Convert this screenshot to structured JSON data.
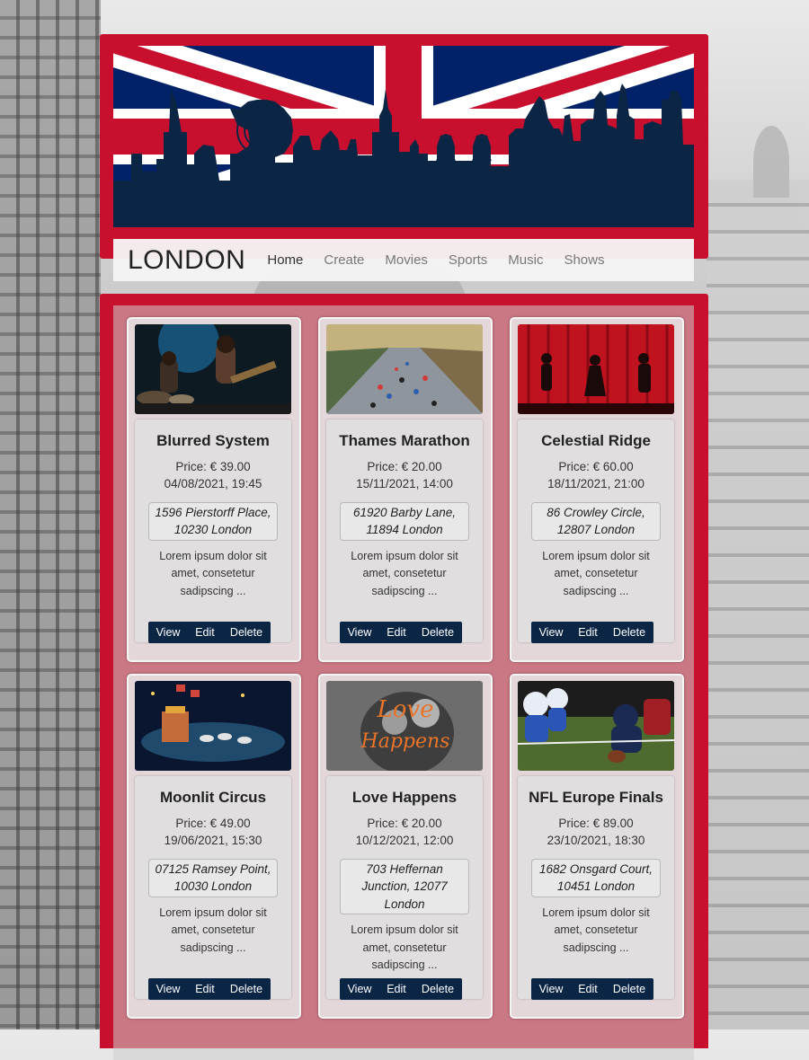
{
  "site": {
    "brand": "LONDON"
  },
  "nav": [
    {
      "label": "Home",
      "active": true
    },
    {
      "label": "Create"
    },
    {
      "label": "Movies"
    },
    {
      "label": "Sports"
    },
    {
      "label": "Music"
    },
    {
      "label": "Shows"
    }
  ],
  "colors": {
    "frame": "#c8102e",
    "button": "#0b2545",
    "flag_blue": "#012169"
  },
  "events": [
    {
      "title": "Blurred System",
      "price": "Price:  € 39.00",
      "date": "04/08/2021, 19:45",
      "address": "1596 Pierstorff Place, 10230 London",
      "description": "Lorem ipsum dolor sit amet, consetetur sadipscing ...",
      "image": "band-on-stage-image"
    },
    {
      "title": "Thames Marathon",
      "price": "Price:  € 20.00",
      "date": "15/11/2021, 14:00",
      "address": "61920 Barby Lane, 11894 London",
      "description": "Lorem ipsum dolor sit amet, consetetur sadipscing ...",
      "image": "marathon-runners-image"
    },
    {
      "title": "Celestial Ridge",
      "price": "Price:  € 60.00",
      "date": "18/11/2021, 21:00",
      "address": "86 Crowley Circle, 12807 London",
      "description": "Lorem ipsum dolor sit amet, consetetur sadipscing ...",
      "image": "theatre-stage-image"
    },
    {
      "title": "Moonlit Circus",
      "price": "Price:  € 49.00",
      "date": "19/06/2021, 15:30",
      "address": "07125 Ramsey Point, 10030 London",
      "description": "Lorem ipsum dolor sit amet, consetetur sadipscing ...",
      "image": "circus-arena-image"
    },
    {
      "title": "Love Happens",
      "price": "Price:  € 20.00",
      "date": "10/12/2021, 12:00",
      "address": "703 Heffernan Junction, 12077 London",
      "description": "Lorem ipsum dolor sit amet, consetetur sadipscing ...",
      "image": "love-happens-poster-image",
      "poster_text": [
        "Love",
        "Happens"
      ]
    },
    {
      "title": "NFL Europe Finals",
      "price": "Price:  € 89.00",
      "date": "23/10/2021, 18:30",
      "address": "1682 Onsgard Court, 10451 London",
      "description": "Lorem ipsum dolor sit amet, consetetur sadipscing ...",
      "image": "american-football-image"
    }
  ],
  "buttons": {
    "view": "View",
    "edit": "Edit",
    "delete": "Delete"
  }
}
